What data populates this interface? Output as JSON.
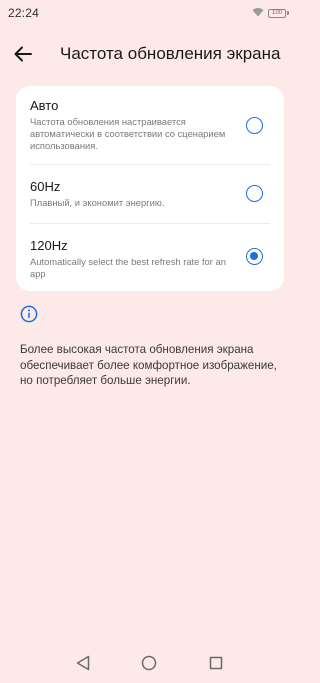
{
  "status_bar": {
    "time": "22:24",
    "battery_level": "100"
  },
  "header": {
    "title": "Частота обновления экрана"
  },
  "options": [
    {
      "title": "Авто",
      "description": "Частота обновления настраивается автоматически в соответствии со сценарием использования.",
      "selected": false
    },
    {
      "title": "60Hz",
      "description": "Плавный, и экономит энергию.",
      "selected": false
    },
    {
      "title": "120Hz",
      "description": "Automatically select the best refresh rate for an app",
      "selected": true
    }
  ],
  "info": {
    "text": "Более высокая частота обновления экрана обеспечивает более комфортное изображение, но потребляет больше энергии."
  },
  "colors": {
    "background": "#fde9e7",
    "accent": "#1c6fe0",
    "card": "#ffffff"
  },
  "icons": {
    "back": "arrow-left-icon",
    "info": "info-icon",
    "nav_back": "triangle-back-icon",
    "nav_home": "circle-home-icon",
    "nav_recents": "square-recents-icon"
  }
}
